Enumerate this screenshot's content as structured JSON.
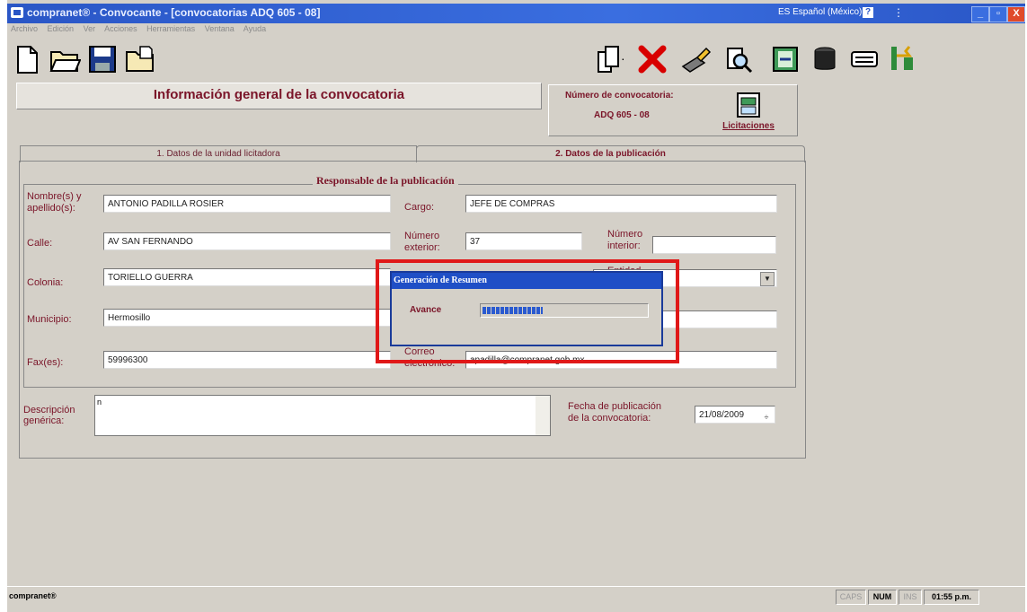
{
  "window": {
    "title": "compranet® - Convocante - [convocatorias ADQ 605 - 08]",
    "language": "ES Español (México)",
    "controls": [
      "_",
      "▫",
      "X"
    ]
  },
  "menu": [
    "Archivo",
    "Edición",
    "Ver",
    "Acciones",
    "Herramientas",
    "Ventana",
    "Ayuda"
  ],
  "toolbar": {
    "icons": [
      "new-document-icon",
      "open-folder-icon",
      "save-disk-icon",
      "open-file-icon",
      "copy-icon",
      "delete-x-icon",
      "edit-pencil-icon",
      "search-icon",
      "import-icon",
      "database-icon",
      "keyboard-icon",
      "run-icon"
    ]
  },
  "header": {
    "title": "Información general de la convocatoria",
    "numero_label": "Número de convocatoria:",
    "numero_value": "ADQ 605 - 08",
    "licitaciones_label": "Licitaciones"
  },
  "tabs": [
    {
      "label": "1. Datos de la unidad licitadora",
      "active": false
    },
    {
      "label": "2. Datos de la publicación",
      "active": true
    }
  ],
  "group": {
    "title": "Responsable de la publicación"
  },
  "form": {
    "nombre_label_1": "Nombre(s) y",
    "nombre_label_2": "apellido(s):",
    "nombre_value": "ANTONIO PADILLA ROSIER",
    "cargo_label": "Cargo:",
    "cargo_value": "JEFE DE COMPRAS",
    "calle_label": "Calle:",
    "calle_value": "AV SAN FERNANDO",
    "num_ext_label_1": "Número",
    "num_ext_label_2": "exterior:",
    "num_ext_value": "37",
    "num_int_label_1": "Número",
    "num_int_label_2": "interior:",
    "num_int_value": "",
    "colonia_label": "Colonia:",
    "colonia_value": "TORIELLO GUERRA",
    "entidad_label": "Entidad",
    "municipio_label": "Municipio:",
    "municipio_value": "Hermosillo",
    "fax_label": "Fax(es):",
    "fax_value": "59996300",
    "correo_label_1": "Correo",
    "correo_label_2": "electrónico:",
    "correo_value": "apadilla@compranet.gob.mx",
    "descripcion_label_1": "Descripción",
    "descripcion_label_2": "genérica:",
    "descripcion_value": "n",
    "fecha_label_1": "Fecha de publicación",
    "fecha_label_2": "de la convocatoria:",
    "fecha_value": "21/08/2009"
  },
  "dialog": {
    "title": "Generación de Resumen",
    "avance_label": "Avance",
    "progress_fraction": 0.37
  },
  "status": {
    "app": "compranet®",
    "caps": "CAPS",
    "num": "NUM",
    "ins": "INS",
    "time": "01:55 p.m."
  },
  "colors": {
    "title_bar": "#2a56c6",
    "label_text": "#7a1428",
    "highlight": "#e01818"
  }
}
